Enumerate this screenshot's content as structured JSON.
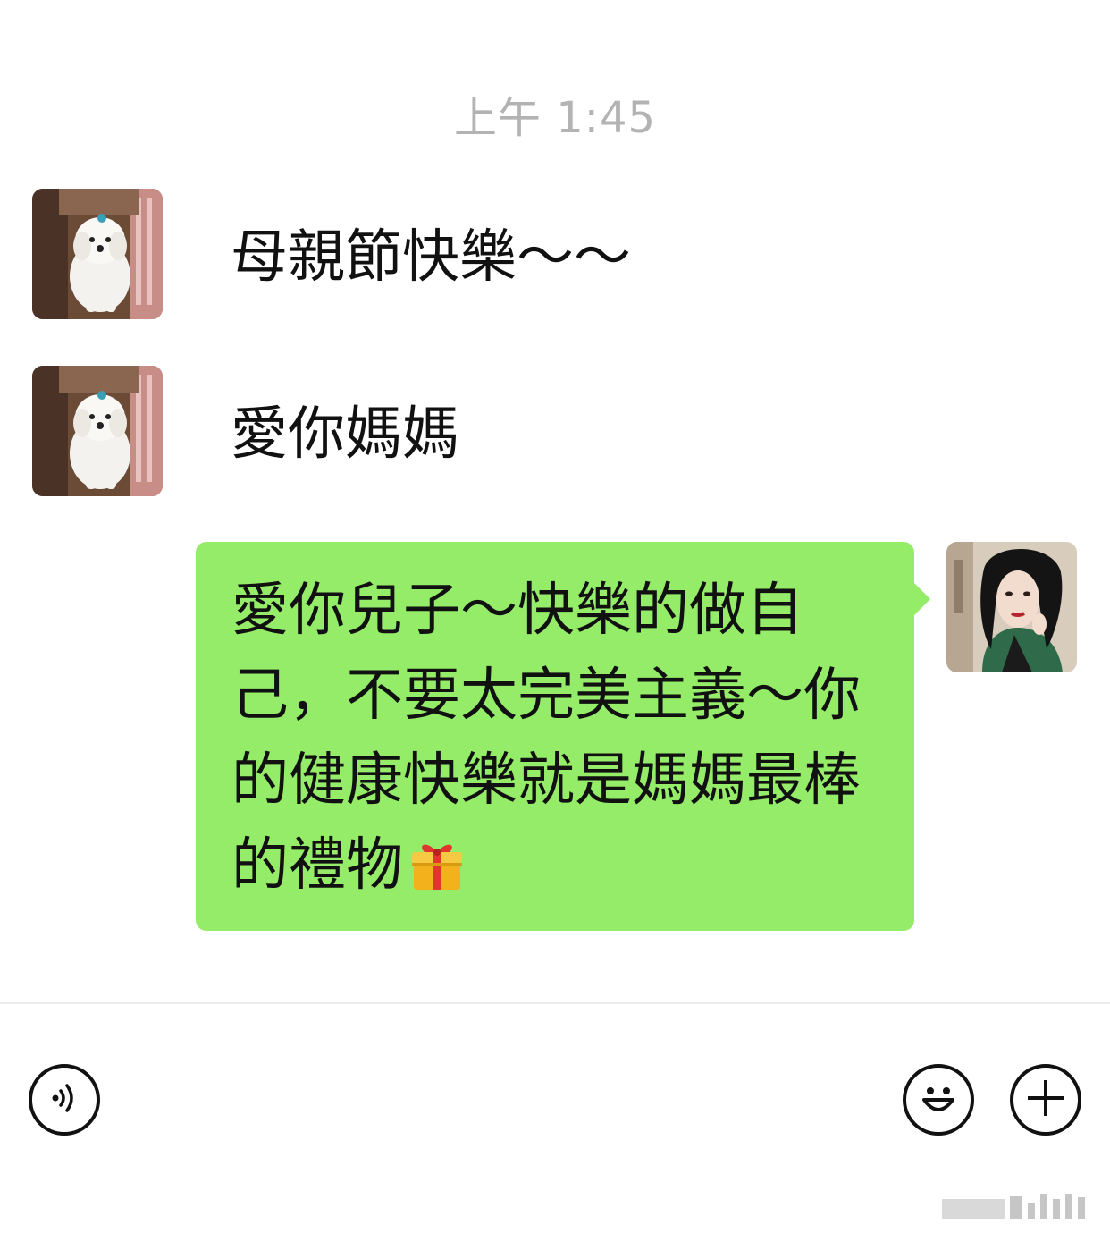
{
  "chat": {
    "timestamp": "上午 1:45",
    "messages": [
      {
        "side": "left",
        "sender": "dog-avatar",
        "text": "母親節快樂～～"
      },
      {
        "side": "left",
        "sender": "dog-avatar",
        "text": "愛你媽媽"
      },
      {
        "side": "right",
        "sender": "woman-avatar",
        "text": "愛你兒子～快樂的做自己，不要太完美主義～你的健康快樂就是媽媽最棒的禮物",
        "emoji": "gift-icon"
      }
    ]
  },
  "input_bar": {
    "left_icon": "voice-icon",
    "right_icons": [
      "emoji-icon",
      "plus-icon"
    ]
  },
  "colors": {
    "background": "#ffffff",
    "outgoing_bubble": "#95ec69",
    "timestamp": "#b3b3b3",
    "text": "#111111"
  }
}
